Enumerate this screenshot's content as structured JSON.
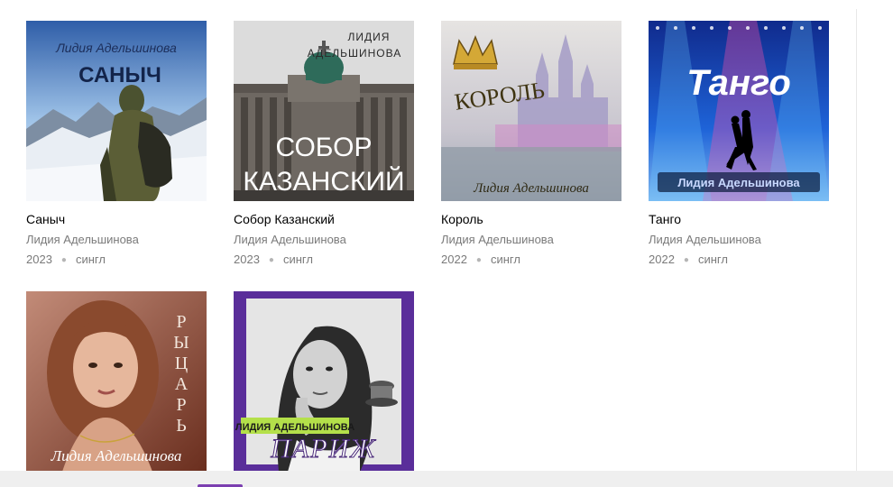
{
  "releases": [
    {
      "title": "Саныч",
      "artist": "Лидия Адельшинова",
      "year": "2023",
      "type": "сингл",
      "cover_text": {
        "artist": "Лидия Адельшинова",
        "title": "САНЫЧ"
      }
    },
    {
      "title": "Собор Казанский",
      "artist": "Лидия Адельшинова",
      "year": "2023",
      "type": "сингл",
      "cover_text": {
        "artist_line1": "ЛИДИЯ",
        "artist_line2": "АДЕЛЬШИНОВА",
        "title_line1": "СОБОР",
        "title_line2": "КАЗАНСКИЙ"
      }
    },
    {
      "title": "Король",
      "artist": "Лидия Адельшинова",
      "year": "2022",
      "type": "сингл",
      "cover_text": {
        "title": "КОРОЛЬ",
        "artist": "Лидия Адельшинова"
      }
    },
    {
      "title": "Танго",
      "artist": "Лидия Адельшинова",
      "year": "2022",
      "type": "сингл",
      "cover_text": {
        "title": "Танго",
        "artist": "Лидия Адельшинова"
      }
    },
    {
      "cover_text": {
        "title": "РЫЦАРЬ",
        "artist": "Лидия  Адельшинова"
      }
    },
    {
      "cover_text": {
        "artist": "ЛИДИЯ АДЕЛЬШИНОВА",
        "title": "ПАРИЖ"
      }
    }
  ],
  "colors": {
    "title": "#000000",
    "secondary": "#7a7a7a",
    "separator": "#e8e8e8",
    "accent": "#7b3fb0"
  }
}
